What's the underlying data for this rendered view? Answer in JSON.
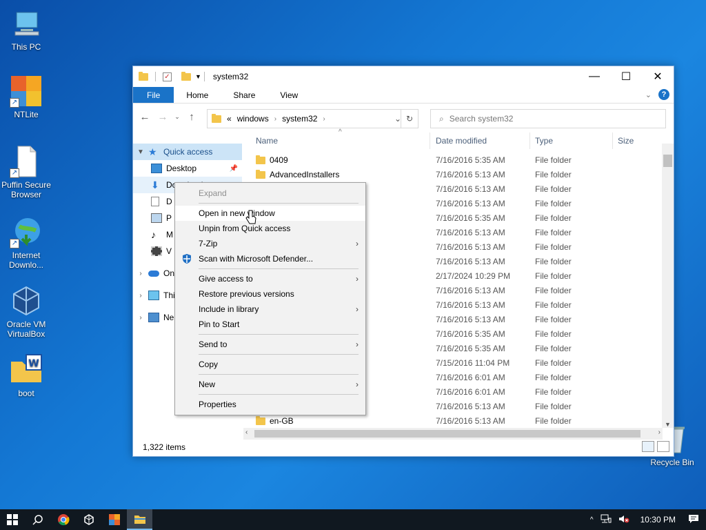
{
  "desktop": {
    "icons": [
      {
        "label": "This PC"
      },
      {
        "label": "NTLite"
      },
      {
        "label": "Puffin Secure Browser"
      },
      {
        "label": "Internet Downlo..."
      },
      {
        "label": "Oracle VM VirtualBox"
      },
      {
        "label": "boot"
      }
    ],
    "recycle_bin": "Recycle Bin"
  },
  "window": {
    "title": "system32",
    "controls": {
      "minimize": "—",
      "maximize": "☐",
      "close": "✕"
    },
    "ribbon_tabs": [
      "File",
      "Home",
      "Share",
      "View"
    ],
    "address": {
      "prefix": "«",
      "crumbs": [
        "windows",
        "system32"
      ]
    },
    "search_placeholder": "Search system32",
    "nav_pane": {
      "quick_access": "Quick access",
      "items": [
        "Desktop",
        "Downloads",
        "D",
        "P",
        "M",
        "V"
      ],
      "groups": [
        "On",
        "Thi",
        "Ne"
      ]
    },
    "columns": {
      "name": "Name",
      "date": "Date modified",
      "type": "Type",
      "size": "Size"
    },
    "rows": [
      {
        "name": "0409",
        "date": "7/16/2016 5:35 AM",
        "type": "File folder"
      },
      {
        "name": "AdvancedInstallers",
        "date": "7/16/2016 5:13 AM",
        "type": "File folder"
      },
      {
        "name": "",
        "date": "7/16/2016 5:13 AM",
        "type": "File folder"
      },
      {
        "name": "",
        "date": "7/16/2016 5:13 AM",
        "type": "File folder"
      },
      {
        "name": "",
        "date": "7/16/2016 5:35 AM",
        "type": "File folder"
      },
      {
        "name": "",
        "date": "7/16/2016 5:13 AM",
        "type": "File folder"
      },
      {
        "name": "",
        "date": "7/16/2016 5:13 AM",
        "type": "File folder"
      },
      {
        "name": "",
        "date": "7/16/2016 5:13 AM",
        "type": "File folder"
      },
      {
        "name": "",
        "date": "2/17/2024 10:29 PM",
        "type": "File folder"
      },
      {
        "name": "",
        "date": "7/16/2016 5:13 AM",
        "type": "File folder"
      },
      {
        "name": "",
        "date": "7/16/2016 5:13 AM",
        "type": "File folder"
      },
      {
        "name": "",
        "date": "7/16/2016 5:13 AM",
        "type": "File folder"
      },
      {
        "name": "",
        "date": "7/16/2016 5:35 AM",
        "type": "File folder"
      },
      {
        "name": "",
        "date": "7/16/2016 5:35 AM",
        "type": "File folder"
      },
      {
        "name": "",
        "date": "7/15/2016 11:04 PM",
        "type": "File folder"
      },
      {
        "name": "",
        "date": "7/16/2016 6:01 AM",
        "type": "File folder"
      },
      {
        "name": "",
        "date": "7/16/2016 6:01 AM",
        "type": "File folder"
      },
      {
        "name": "",
        "date": "7/16/2016 5:13 AM",
        "type": "File folder"
      },
      {
        "name": "en-GB",
        "date": "7/16/2016 5:13 AM",
        "type": "File folder"
      }
    ],
    "status": "1,322 items"
  },
  "context_menu": {
    "items": [
      {
        "label": "Expand"
      },
      {
        "label": "Open in new window"
      },
      {
        "label": "Unpin from Quick access"
      },
      {
        "label": "7-Zip"
      },
      {
        "label": "Scan with Microsoft Defender..."
      },
      {
        "label": "Give access to"
      },
      {
        "label": "Restore previous versions"
      },
      {
        "label": "Include in library"
      },
      {
        "label": "Pin to Start"
      },
      {
        "label": "Send to"
      },
      {
        "label": "Copy"
      },
      {
        "label": "New"
      },
      {
        "label": "Properties"
      }
    ]
  },
  "taskbar": {
    "clock": "10:30 PM"
  },
  "colors": {
    "accent": "#1a73c8",
    "folder": "#f3c54b",
    "selection": "#cce4f7"
  }
}
